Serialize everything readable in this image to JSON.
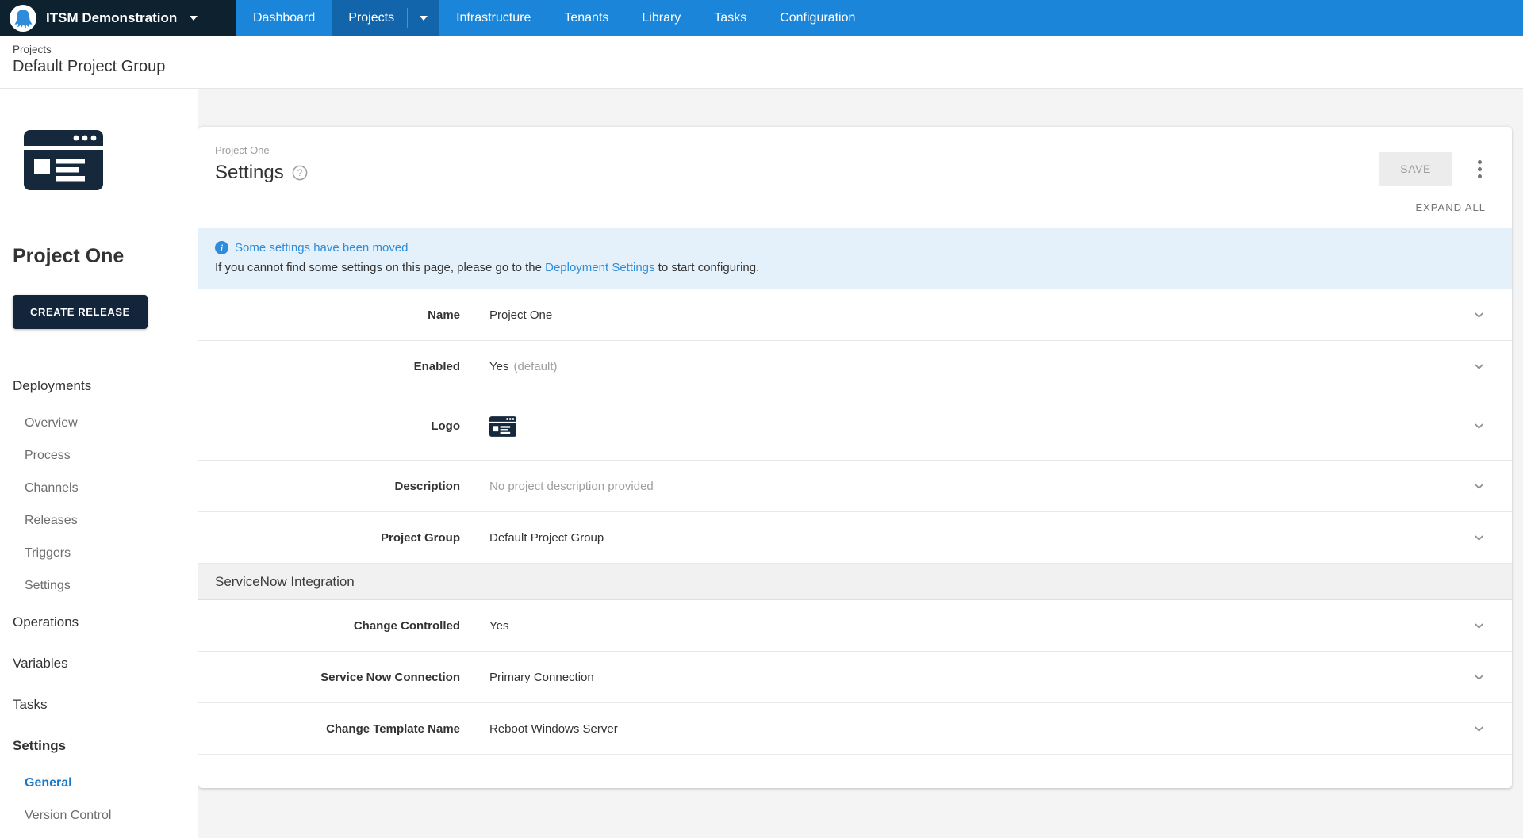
{
  "colors": {
    "nav_blue": "#1b86d9",
    "nav_active_blue": "#1265ab",
    "brand_dark": "#0d212f",
    "accent_blue": "#2e8cd8",
    "callout_bg": "#e4f1fb",
    "sidebar_active_link": "#1878c8",
    "logo_navy": "#15283c"
  },
  "top_nav": {
    "brand": {
      "label": "ITSM Demonstration",
      "logo": "octopus-logo"
    },
    "items": [
      {
        "label": "Dashboard",
        "active": false
      },
      {
        "label": "Projects",
        "active": true,
        "has_dropdown": true
      },
      {
        "label": "Infrastructure",
        "active": false
      },
      {
        "label": "Tenants",
        "active": false
      },
      {
        "label": "Library",
        "active": false
      },
      {
        "label": "Tasks",
        "active": false
      },
      {
        "label": "Configuration",
        "active": false
      }
    ]
  },
  "breadcrumb": {
    "section": "Projects",
    "page_title": "Default Project Group"
  },
  "sidebar": {
    "project_name": "Project One",
    "create_release_button": "CREATE RELEASE",
    "nav": [
      {
        "label": "Deployments",
        "level": "top"
      },
      {
        "label": "Overview",
        "level": "sub"
      },
      {
        "label": "Process",
        "level": "sub"
      },
      {
        "label": "Channels",
        "level": "sub"
      },
      {
        "label": "Releases",
        "level": "sub"
      },
      {
        "label": "Triggers",
        "level": "sub"
      },
      {
        "label": "Settings",
        "level": "sub"
      },
      {
        "label": "Operations",
        "level": "top"
      },
      {
        "label": "Variables",
        "level": "top"
      },
      {
        "label": "Tasks",
        "level": "top"
      },
      {
        "label": "Settings",
        "level": "top",
        "active_group": true
      },
      {
        "label": "General",
        "level": "sub",
        "active": true
      },
      {
        "label": "Version Control",
        "level": "sub"
      }
    ]
  },
  "main": {
    "header": {
      "context": "Project One",
      "title": "Settings",
      "help_icon": "question-circle",
      "save_button": "SAVE",
      "overflow_icon": "kebab-menu",
      "expand_all": "EXPAND ALL"
    },
    "callout": {
      "icon": "info-circle",
      "title": "Some settings have been moved",
      "body_prefix": "If you cannot find some settings on this page, please go to the ",
      "link_text": "Deployment Settings",
      "body_suffix": " to start configuring."
    },
    "settings_rows": [
      {
        "label": "Name",
        "value": "Project One"
      },
      {
        "label": "Enabled",
        "value": "Yes",
        "value_suffix": "(default)"
      },
      {
        "label": "Logo",
        "value_icon": "project-logo"
      },
      {
        "label": "Description",
        "value": "No project description provided",
        "muted": true
      },
      {
        "label": "Project Group",
        "value": "Default Project Group"
      }
    ],
    "section_header": "ServiceNow Integration",
    "servicenow_rows": [
      {
        "label": "Change Controlled",
        "value": "Yes"
      },
      {
        "label": "Service Now Connection",
        "value": "Primary Connection"
      },
      {
        "label": "Change Template Name",
        "value": "Reboot Windows Server"
      }
    ]
  }
}
